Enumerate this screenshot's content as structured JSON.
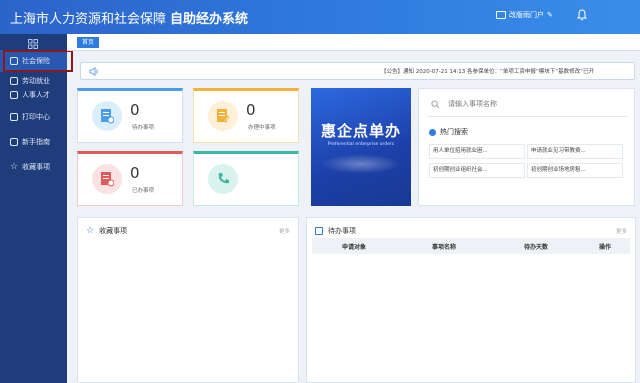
{
  "header": {
    "title_main": "上海市人力资源和社会保障",
    "title_sub": "自助经办系统",
    "switch_label": "改版雨门户",
    "colors": {
      "header_start": "#2c63c9",
      "header_end": "#3a8ee8",
      "sidebar": "#1f3d7a",
      "accent": "#2f7be0"
    }
  },
  "sidebar": {
    "items": [
      {
        "label": "社会保险",
        "icon": "shield-icon",
        "active": true
      },
      {
        "label": "劳动就业",
        "icon": "briefcase-icon"
      },
      {
        "label": "人事人才",
        "icon": "person-icon"
      },
      {
        "label": "打印中心",
        "icon": "printer-icon"
      },
      {
        "label": "新手指南",
        "icon": "book-icon"
      },
      {
        "label": "收藏事项",
        "icon": "star-icon"
      }
    ]
  },
  "tabs": [
    {
      "label": "首页"
    }
  ],
  "notice": {
    "text": "【公告】通知 2020-07-21 14:13 各参保单位：“单项工资申报”模块下“基数修改”已开"
  },
  "stats": [
    {
      "value": "0",
      "label": "待办事项",
      "icon": "document-clock-icon",
      "color": "#4a9de6"
    },
    {
      "value": "0",
      "label": "办理中事项",
      "icon": "document-edit-icon",
      "color": "#f0b23a"
    },
    {
      "value": "0",
      "label": "已办事项",
      "icon": "document-check-icon",
      "color": "#e05a5a"
    },
    {
      "value": "",
      "label": "",
      "icon": "phone-icon",
      "color": "#3db6a3"
    }
  ],
  "banner": {
    "title": "惠企点单办",
    "subtitle": "Preferential enterprise orders"
  },
  "search": {
    "placeholder": "请输入事项名称",
    "hot_title": "热门搜索",
    "hot_items": [
      "用人单位招用就业困...",
      "申请就业见习带教费...",
      "初创期创业组织社会...",
      "初创期创业场地房租..."
    ]
  },
  "favorites": {
    "title": "收藏事项",
    "more": "更多"
  },
  "todo": {
    "title": "待办事项",
    "more": "更多",
    "columns": [
      "申请对象",
      "事项名称",
      "待办天数",
      "操作"
    ]
  }
}
